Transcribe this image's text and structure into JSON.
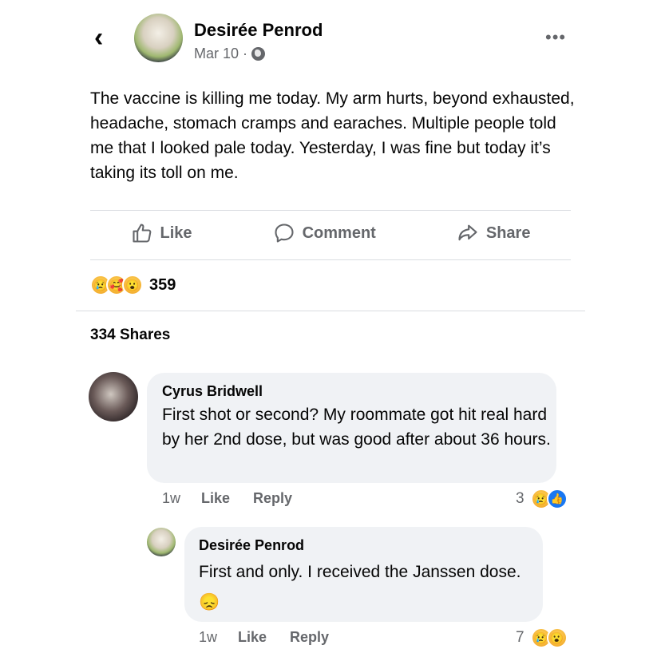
{
  "post": {
    "author": "Desirée Penrod",
    "date": "Mar 10 ·",
    "text": "The vaccine is killing me today. My arm hurts, beyond exhausted, headache, stomach cramps and earaches. Multiple people told me that I looked pale today. Yesterday, I was fine but today it’s taking its toll on me.",
    "actions": {
      "like": "Like",
      "comment": "Comment",
      "share": "Share"
    },
    "reaction_count": "359",
    "shares": "334 Shares"
  },
  "comments": [
    {
      "author": "Cyrus Bridwell",
      "text": "First shot or second? My roommate got hit real hard by her 2nd dose, but was good after about 36 hours.",
      "time": "1w",
      "like": "Like",
      "reply": "Reply",
      "reaction_count": "3"
    },
    {
      "author": "Desirée Penrod",
      "text": "First and only. I received the Janssen dose.",
      "emoji": "😞",
      "time": "1w",
      "like": "Like",
      "reply": "Reply",
      "reaction_count": "7"
    }
  ]
}
